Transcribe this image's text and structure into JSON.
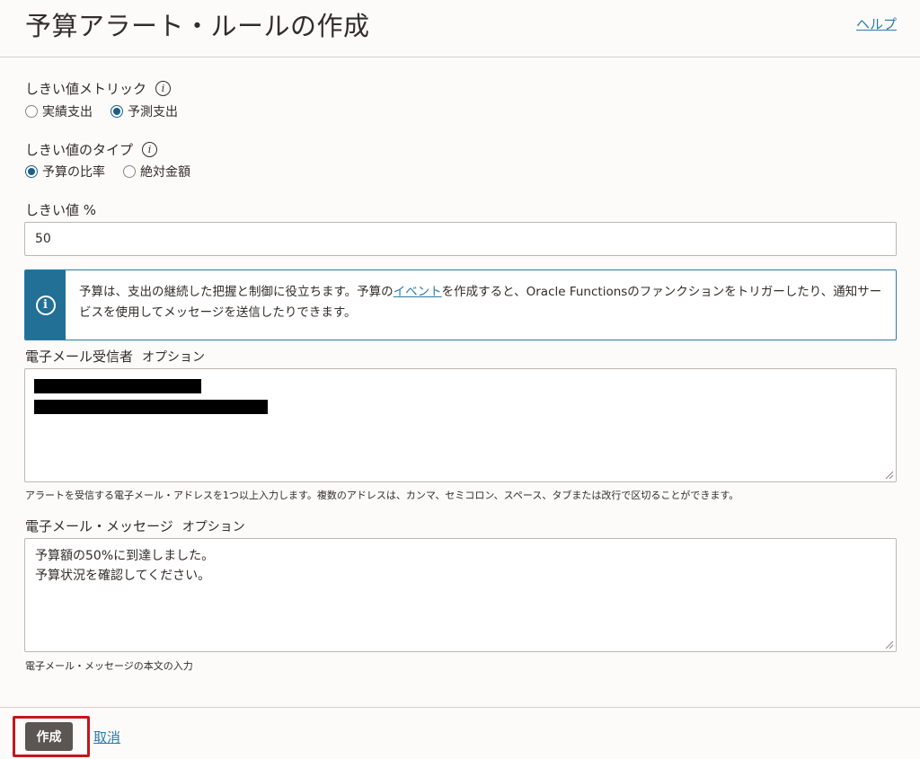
{
  "header": {
    "title": "予算アラート・ルールの作成",
    "help_link": "ヘルプ"
  },
  "threshold_metric": {
    "label": "しきい値メトリック",
    "options": [
      {
        "label": "実績支出",
        "selected": false
      },
      {
        "label": "予測支出",
        "selected": true
      }
    ]
  },
  "threshold_type": {
    "label": "しきい値のタイプ",
    "options": [
      {
        "label": "予算の比率",
        "selected": true
      },
      {
        "label": "絶対金額",
        "selected": false
      }
    ]
  },
  "threshold_value": {
    "label": "しきい値 %",
    "value": "50"
  },
  "info_box": {
    "text_before": "予算は、支出の継続した把握と制御に役立ちます。予算の",
    "link": "イベント",
    "text_after": "を作成すると、Oracle Functionsのファンクションをトリガーしたり、通知サービスを使用してメッセージを送信したりできます。"
  },
  "email_recipients": {
    "label": "電子メール受信者",
    "optional": "オプション",
    "hint": "アラートを受信する電子メール・アドレスを1つ以上入力します。複数のアドレスは、カンマ、セミコロン、スペース、タブまたは改行で区切ることができます。"
  },
  "email_message": {
    "label": "電子メール・メッセージ",
    "optional": "オプション",
    "lines": [
      "予算額の50%に到達しました。",
      "予算状況を確認してください。"
    ],
    "hint": "電子メール・メッセージの本文の入力"
  },
  "footer": {
    "create_label": "作成",
    "cancel_label": "取消"
  }
}
